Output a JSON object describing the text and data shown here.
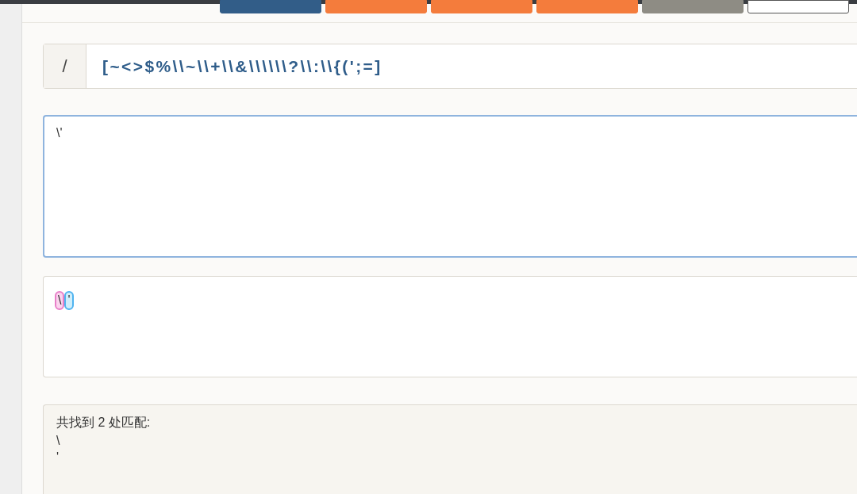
{
  "toolbar": {
    "buttons": [
      {
        "color": "#325d88"
      },
      {
        "color": "#f47c3c"
      },
      {
        "color": "#f47c3c"
      },
      {
        "color": "#f47c3c"
      },
      {
        "color": "#8e8c84"
      },
      {
        "color": "#ffffff"
      }
    ]
  },
  "regex": {
    "delimiter": "/",
    "pattern": "[~<>$%\\\\~\\\\+\\\\&\\\\\\\\\\\\?\\\\:\\\\{(';=]"
  },
  "test_input": {
    "value": "\\'"
  },
  "result": {
    "segments": [
      {
        "text": "\\",
        "color": "#e87fc8"
      },
      {
        "text": "'",
        "color": "#4fb3f0"
      }
    ]
  },
  "matches": {
    "summary": "共找到 2 处匹配:",
    "items": [
      "\\",
      "'"
    ]
  }
}
